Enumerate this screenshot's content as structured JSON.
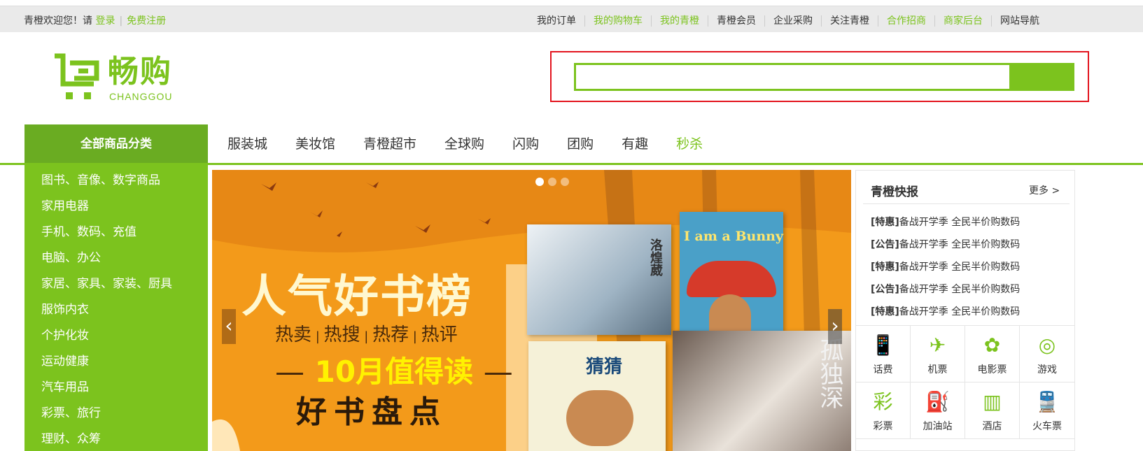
{
  "topbar": {
    "welcome": "青橙欢迎您！请",
    "login": "登录",
    "register": "免费注册",
    "links": [
      {
        "label": "我的订单",
        "green": false
      },
      {
        "label": "我的购物车",
        "green": true
      },
      {
        "label": "我的青橙",
        "green": true
      },
      {
        "label": "青橙会员",
        "green": false
      },
      {
        "label": "企业采购",
        "green": false
      },
      {
        "label": "关注青橙",
        "green": false
      },
      {
        "label": "合作招商",
        "green": true
      },
      {
        "label": "商家后台",
        "green": true
      },
      {
        "label": "网站导航",
        "green": false
      }
    ]
  },
  "logo": {
    "cn": "畅购",
    "en": "CHANGGOU"
  },
  "search": {
    "value": "",
    "placeholder": ""
  },
  "nav": {
    "all_categories": "全部商品分类",
    "items": [
      "服装城",
      "美妆馆",
      "青橙超市",
      "全球购",
      "闪购",
      "团购",
      "有趣",
      "秒杀"
    ]
  },
  "sidebar": {
    "categories": [
      "图书、音像、数字商品",
      "家用电器",
      "手机、数码、充值",
      "电脑、办公",
      "家居、家具、家装、厨具",
      "服饰内衣",
      "个护化妆",
      "运动健康",
      "汽车用品",
      "彩票、旅行",
      "理财、众筹"
    ]
  },
  "banner": {
    "headline": "人气好书榜",
    "tags": [
      "热卖",
      "热搜",
      "热荐",
      "热评"
    ],
    "sub1": "10月值得读",
    "sub2": "好书盘点",
    "dots": 3,
    "active_dot": 0,
    "book_titles": [
      "I am a Bunny",
      "猜猜",
      "洛煌葳",
      "孤独深"
    ]
  },
  "news": {
    "title": "青橙快报",
    "more": "更多 >",
    "items": [
      {
        "tag": "[特惠]",
        "text": "备战开学季 全民半价购数码"
      },
      {
        "tag": "[公告]",
        "text": "备战开学季 全民半价购数码"
      },
      {
        "tag": "[特惠]",
        "text": "备战开学季 全民半价购数码"
      },
      {
        "tag": "[公告]",
        "text": "备战开学季 全民半价购数码"
      },
      {
        "tag": "[特惠]",
        "text": "备战开学季 全民半价购数码"
      }
    ],
    "services": [
      {
        "label": "话费",
        "icon": "phone-icon"
      },
      {
        "label": "机票",
        "icon": "plane-icon"
      },
      {
        "label": "电影票",
        "icon": "film-icon"
      },
      {
        "label": "游戏",
        "icon": "gamepad-icon"
      },
      {
        "label": "彩票",
        "icon": "lottery-icon"
      },
      {
        "label": "加油站",
        "icon": "gas-station-icon"
      },
      {
        "label": "酒店",
        "icon": "hotel-icon"
      },
      {
        "label": "火车票",
        "icon": "train-icon"
      }
    ]
  },
  "colors": {
    "brand_green": "#7cc31e",
    "dark_green": "#6aac22",
    "search_frame_red": "#e3141e",
    "banner_orange": "#f39a1a"
  }
}
